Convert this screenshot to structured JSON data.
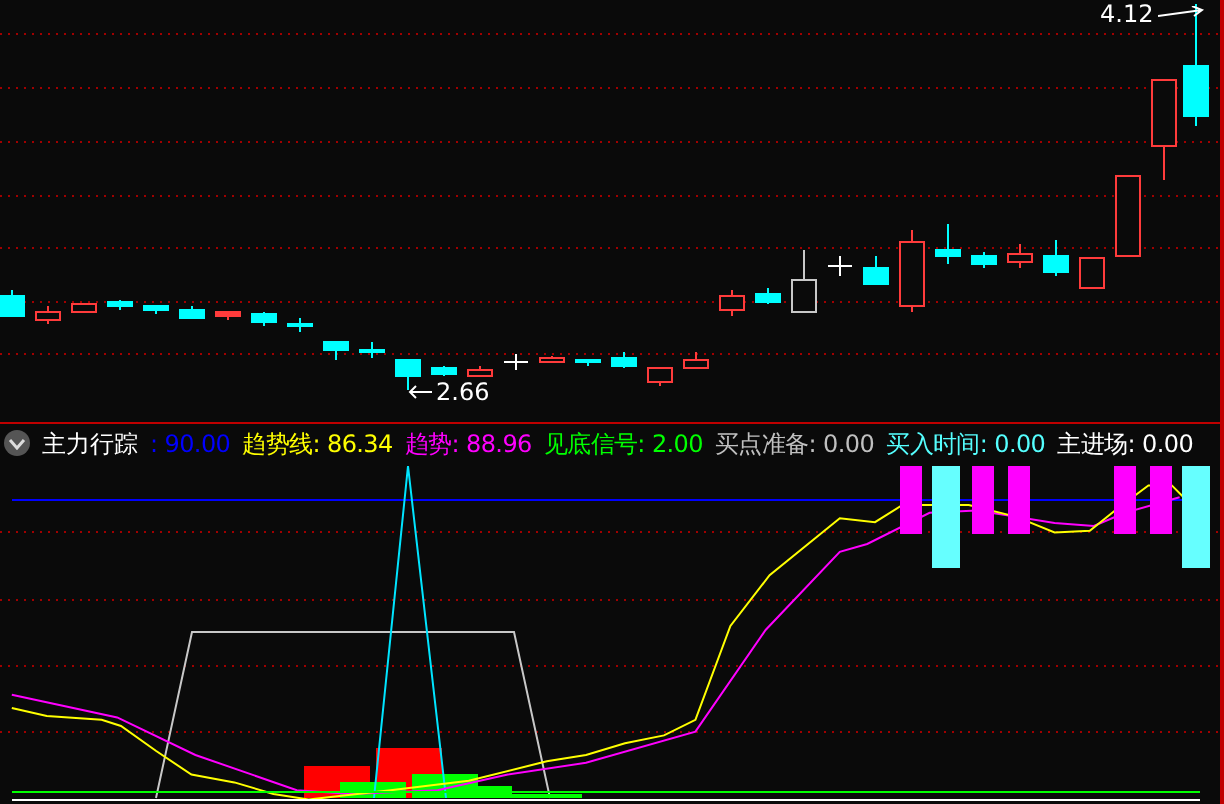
{
  "price_chart": {
    "high_label": "4.12",
    "low_label": "2.66"
  },
  "indicator": {
    "title": "主力行踪",
    "readings": [
      {
        "label": ":",
        "value": "90.00",
        "color": "#0000ff"
      },
      {
        "label": "趋势线:",
        "value": "86.34",
        "color": "#ffff00"
      },
      {
        "label": "趋势:",
        "value": "88.96",
        "color": "#ff00ff"
      },
      {
        "label": "见底信号:",
        "value": "2.00",
        "color": "#00ff00"
      },
      {
        "label": "买点准备:",
        "value": "0.00",
        "color": "#c0c0c0"
      },
      {
        "label": "买入时间:",
        "value": "0.00",
        "color": "#55ffff"
      },
      {
        "label": "主进场:",
        "value": "0.00",
        "color": "#ffffff"
      }
    ]
  }
}
